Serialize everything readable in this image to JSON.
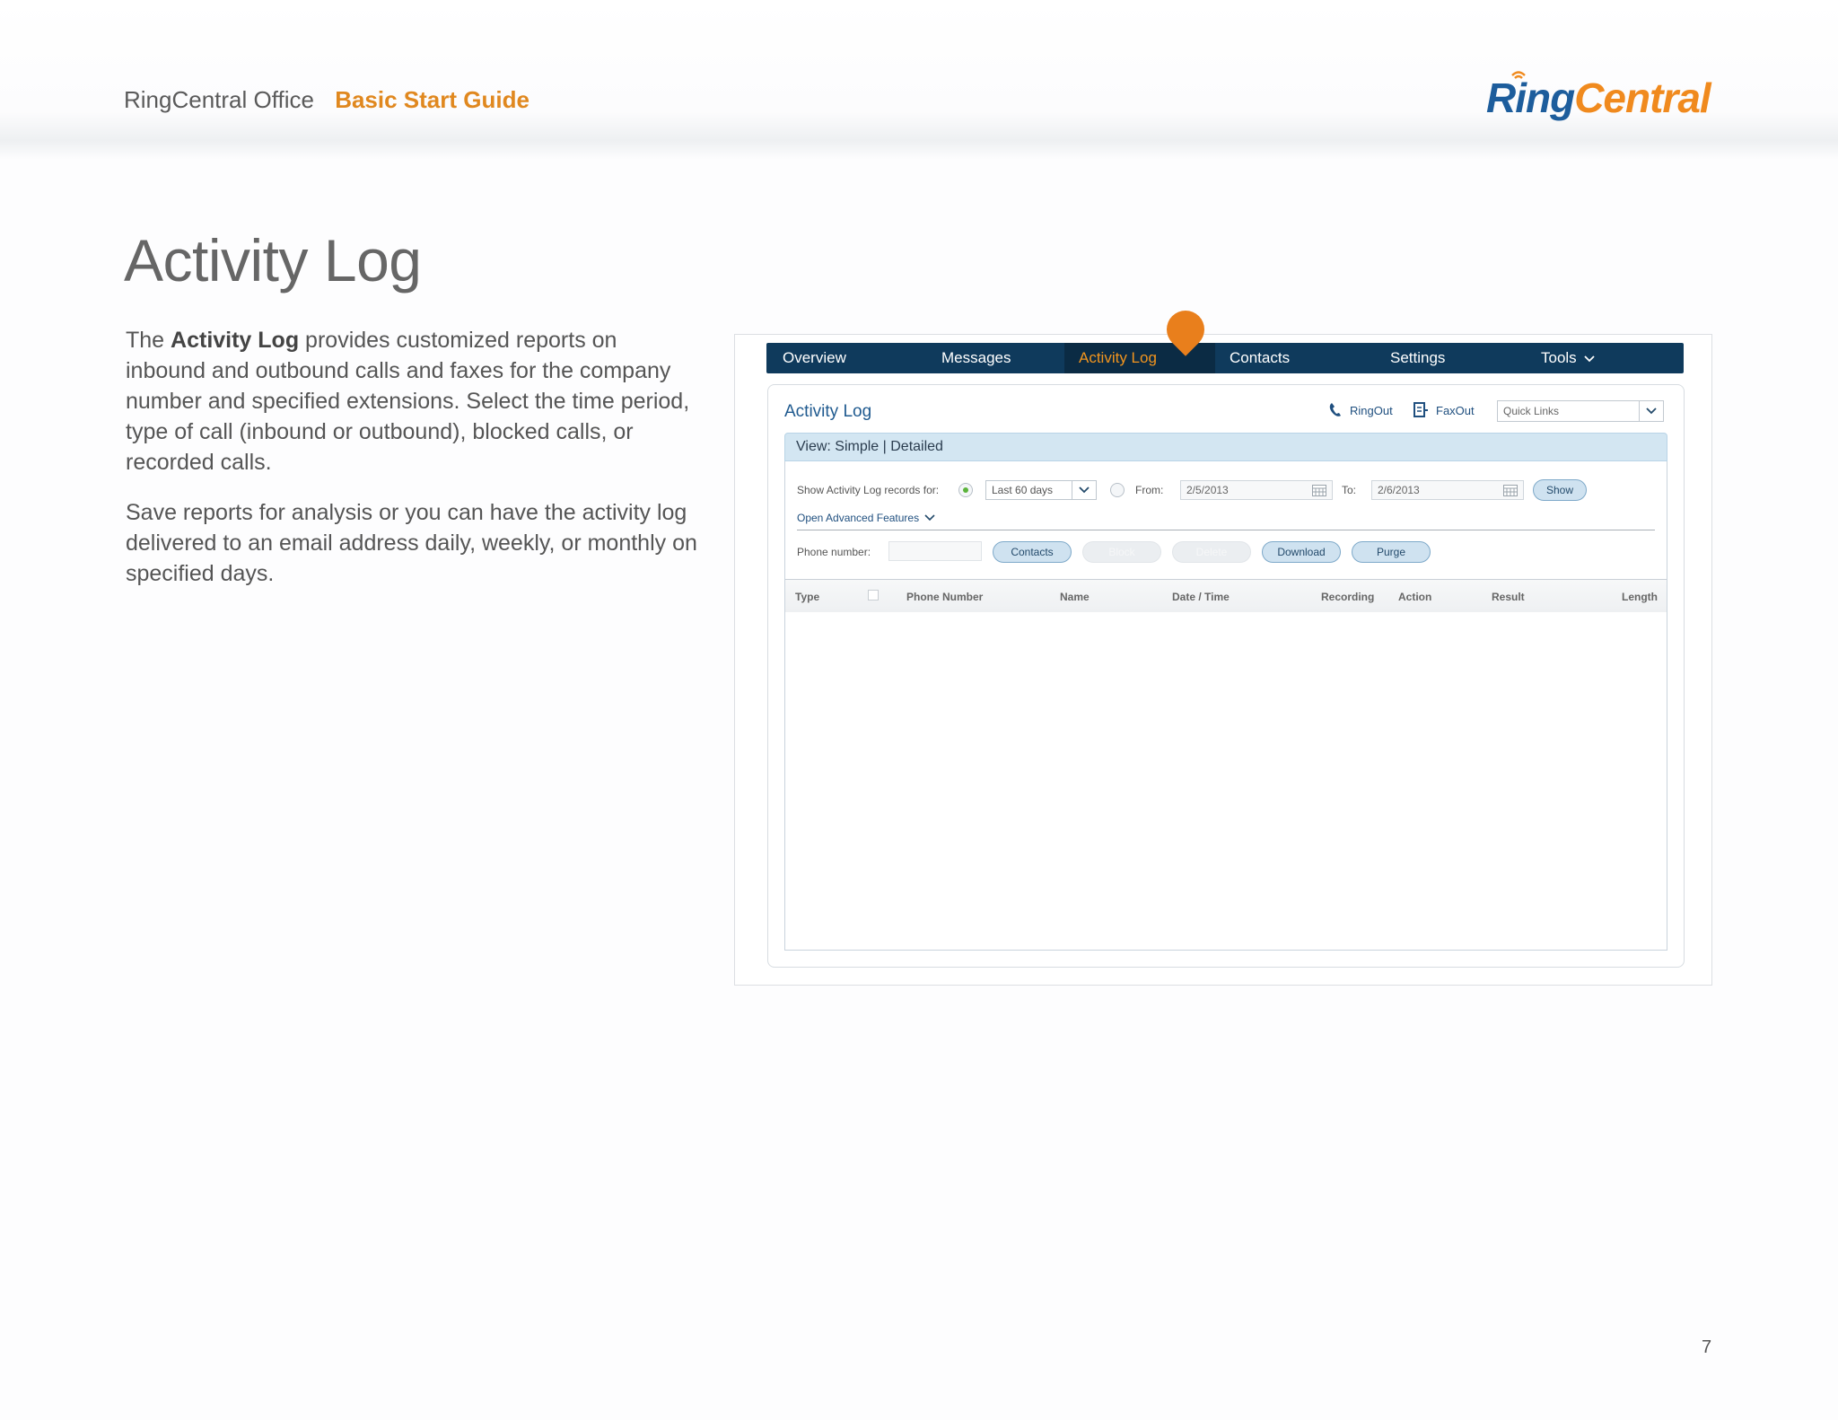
{
  "header": {
    "product": "RingCentral Office",
    "guide": "Basic Start Guide",
    "logo_ring": "Ring",
    "logo_central": "Central",
    "brand_blue": "#1d5d9c",
    "brand_orange": "#f08a1e"
  },
  "page": {
    "title": "Activity Log",
    "para1_lead": "The ",
    "para1_bold": "Activity Log",
    "para1_rest": " provides customized reports on inbound and outbound calls and faxes for the company number and specified extensions. Select the time period, type of call (inbound or outbound), blocked calls, or recorded calls.",
    "para2": "Save reports for analysis or you can have the activity log delivered to an email address daily, weekly, or monthly on specified days.",
    "page_number": "7"
  },
  "screenshot": {
    "nav_tabs": [
      {
        "label": "Overview"
      },
      {
        "label": "Messages"
      },
      {
        "label": "Activity Log",
        "active": true
      },
      {
        "label": "Contacts"
      },
      {
        "label": "Settings"
      },
      {
        "label": "Tools"
      }
    ],
    "panel_title": "Activity Log",
    "ringout_label": "RingOut",
    "faxout_label": "FaxOut",
    "quick_links": "Quick Links",
    "view_prefix": "View: ",
    "view_simple": "Simple",
    "view_sep": " | ",
    "view_detailed": "Detailed",
    "show_records_label": "Show Activity Log records for:",
    "period_value": "Last 60 days",
    "from_label": "From:",
    "from_value": "2/5/2013",
    "to_label": "To:",
    "to_value": "2/6/2013",
    "show_button": "Show",
    "advanced_link": "Open Advanced Features",
    "phone_label": "Phone number:",
    "buttons": {
      "contacts": "Contacts",
      "block": "Block",
      "delete": "Delete",
      "download": "Download",
      "purge": "Purge"
    },
    "columns": [
      "Type",
      "Phone Number",
      "Name",
      "Date / Time",
      "Recording",
      "Action",
      "Result",
      "Length"
    ],
    "accent_color": "#f2951e",
    "nav_color": "#0f3a5c"
  }
}
